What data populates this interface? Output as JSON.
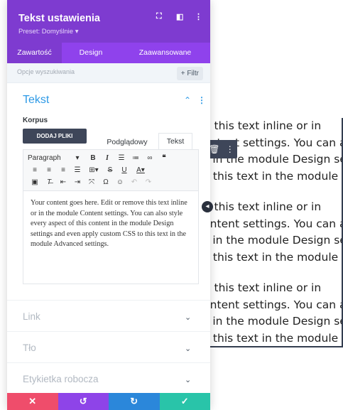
{
  "preview": {
    "paragraphs": [
      [
        "Edit or remove this text inline or in",
        "the module Content settings. You can also style every aspect",
        "of this content in the module Design settings and even apply",
        "custom CSS to this text in the module Advanced settings."
      ],
      [
        "Edit or remove this text inline or in",
        "the module Content settings. You can also style every aspect",
        "of this content in the module Design settings and even apply",
        "custom CSS to this text in the module Advanced settings."
      ],
      [
        "Edit or remove this text inline or in",
        "the module Content settings. You can also style every aspect",
        "of this content in the module Design settings and even apply",
        "custom CSS to this text in the module Advanced settings."
      ]
    ]
  },
  "panel": {
    "title": "Tekst ustawienia",
    "preset": "Preset: Domyślnie ▾",
    "tabs": [
      "Zawartość",
      "Design",
      "Zaawansowane"
    ],
    "search_placeholder": "Opcje wyszukiwania",
    "filter_label": "+ Filtr",
    "section_title": "Tekst",
    "body_label": "Korpus",
    "upload_label": "DODAJ PLIKI",
    "editor_tabs": [
      "Podglądowy",
      "Tekst"
    ],
    "format_select": "Paragraph",
    "editor_text": "Your content goes here. Edit or remove this text inline or in the module Content settings. You can also style every aspect of this content in the module Design settings and even apply custom CSS to this text in the module Advanced settings.",
    "sections": [
      "Link",
      "Tło",
      "Etykietka robocza"
    ]
  },
  "colors": {
    "header": "#7e3bd0",
    "tabs": "#8f42ec",
    "accent": "#2e9ae6",
    "cancel": "#ef4d6b",
    "undo": "#8e44e8",
    "redo": "#2b87da",
    "save": "#29c4a9"
  },
  "icons": {
    "header": [
      "focus-icon",
      "split-view-icon",
      "more-vertical-icon"
    ],
    "bottom_bar": [
      "close-icon",
      "undo-icon",
      "redo-icon",
      "check-icon"
    ]
  }
}
